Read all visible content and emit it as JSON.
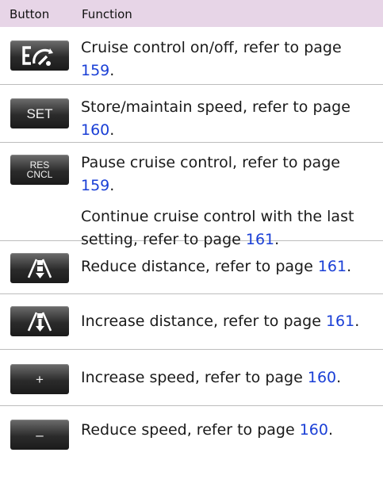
{
  "header": {
    "col_button": "Button",
    "col_function": "Function"
  },
  "rows": [
    {
      "icon": "cruise-control-icon",
      "text": "Cruise control on/off, refer to page ",
      "page": "159",
      "end": "."
    },
    {
      "label": "SET",
      "text": "Store/maintain speed, refer to page ",
      "page": "160",
      "end": "."
    },
    {
      "label_line1": "RES",
      "label_line2": "CNCL",
      "text": "Pause cruise control, refer to page ",
      "page": "159",
      "end": ".",
      "text2": "Continue cruise control with the last setting, refer to page ",
      "page2": "161",
      "end2": "."
    },
    {
      "icon": "reduce-distance-icon",
      "text": "Reduce distance, refer to page ",
      "page": "161",
      "end": "."
    },
    {
      "icon": "increase-distance-icon",
      "text": "Increase distance, refer to page ",
      "page": "161",
      "end": "."
    },
    {
      "label": "+",
      "text": "Increase speed, refer to page ",
      "page": "160",
      "end": "."
    },
    {
      "label": "–",
      "text": "Reduce speed, refer to page ",
      "page": "160",
      "end": "."
    }
  ]
}
